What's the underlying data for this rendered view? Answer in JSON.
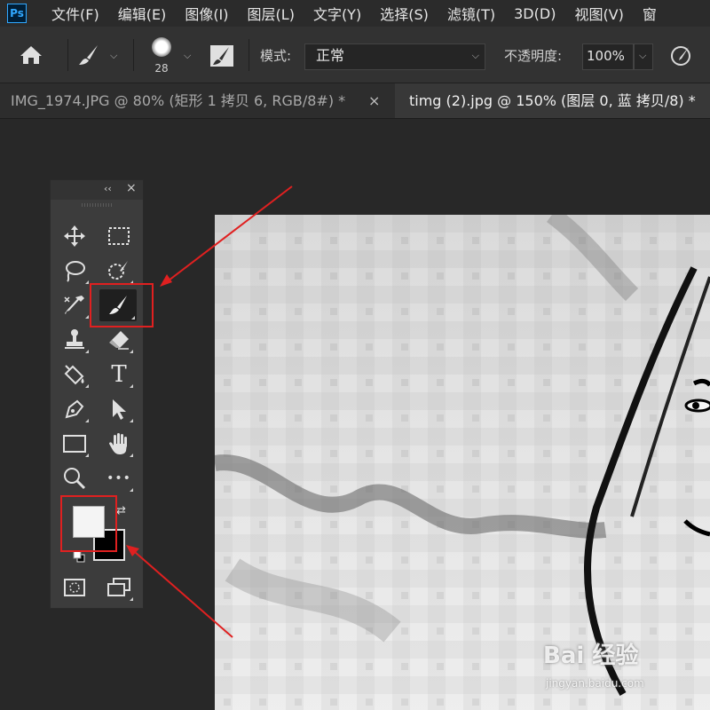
{
  "app": {
    "logo": "Ps"
  },
  "menu": [
    "文件(F)",
    "编辑(E)",
    "图像(I)",
    "图层(L)",
    "文字(Y)",
    "选择(S)",
    "滤镜(T)",
    "3D(D)",
    "视图(V)",
    "窗"
  ],
  "options": {
    "brush_size": "28",
    "mode_label": "模式:",
    "mode_value": "正常",
    "opacity_label": "不透明度:",
    "opacity_value": "100%"
  },
  "tabs": [
    {
      "label": "IMG_1974.JPG @ 80% (矩形 1 拷贝 6, RGB/8#) *",
      "active": false,
      "close": "×"
    },
    {
      "label": "timg (2).jpg @ 150% (图层 0, 蓝 拷贝/8) *",
      "active": true
    }
  ],
  "panel": {
    "collapse": "‹‹",
    "close": "×"
  },
  "tools": [
    {
      "name": "move-tool"
    },
    {
      "name": "marquee-tool"
    },
    {
      "name": "lasso-tool"
    },
    {
      "name": "quick-selection-tool"
    },
    {
      "name": "eyedropper-tool"
    },
    {
      "name": "brush-tool",
      "selected": true
    },
    {
      "name": "clone-stamp-tool"
    },
    {
      "name": "eraser-tool"
    },
    {
      "name": "paint-bucket-tool"
    },
    {
      "name": "type-tool",
      "glyph": "T"
    },
    {
      "name": "pen-tool"
    },
    {
      "name": "path-selection-tool"
    },
    {
      "name": "rectangle-tool"
    },
    {
      "name": "hand-tool"
    },
    {
      "name": "zoom-tool"
    },
    {
      "name": "more-tools",
      "glyph": "•••"
    }
  ],
  "colors": {
    "foreground": "#f4f4f4",
    "background": "#000000",
    "annotation": "#e02020"
  },
  "watermark": {
    "text": "Bai 经验",
    "url": "jingyan.baidu.com"
  }
}
